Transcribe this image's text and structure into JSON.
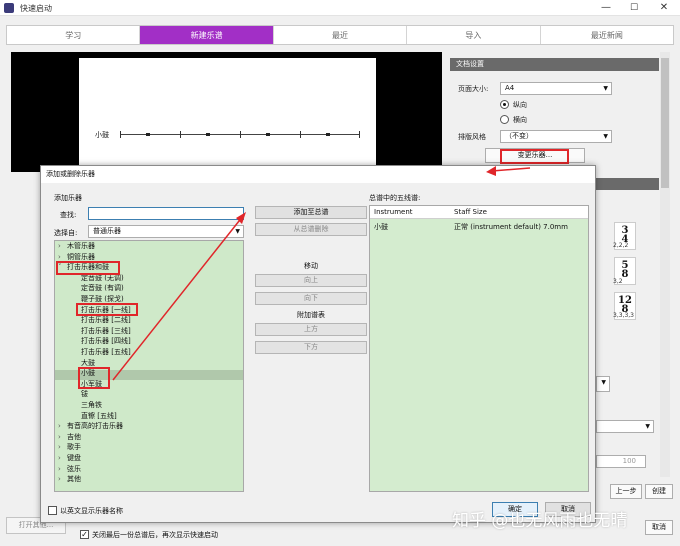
{
  "window": {
    "title": "快速启动",
    "minimize": "—",
    "maximize": "☐",
    "close": "✕"
  },
  "tabs": [
    {
      "label": "学习"
    },
    {
      "label": "新建乐谱"
    },
    {
      "label": "最近"
    },
    {
      "label": "导入"
    },
    {
      "label": "最近新闻"
    }
  ],
  "score": {
    "instrument_label": "小鼓"
  },
  "right_panel": {
    "header": "文档设置",
    "page_size_label": "页面大小:",
    "page_size_value": "A4",
    "portrait": "纵向",
    "landscape": "横向",
    "style_label": "排版风格",
    "style_value": "（不变）",
    "change_instruments": "变更乐器...",
    "time_sigs": [
      {
        "top": "3",
        "bottom": "4",
        "label": "2,2,2"
      },
      {
        "top": "5",
        "bottom": "8",
        "label": "3,2"
      },
      {
        "top": "12",
        "bottom": "8",
        "label": "3,3,3,3"
      }
    ],
    "tempo_value": "100"
  },
  "bottom": {
    "open_other": "打开其他...",
    "show_checkbox_label": "关闭最后一份总谱后，再次显示快速启动",
    "prev": "上一步",
    "create": "创建",
    "cancel": "取消"
  },
  "dialog": {
    "title": "添加或删除乐器",
    "add_label": "添加乐器",
    "search_label": "查找:",
    "search_value": "",
    "select_label": "选择自:",
    "select_value": "普通乐器",
    "tree": [
      {
        "label": "木管乐器",
        "level": 0,
        "exp": "›"
      },
      {
        "label": "铜管乐器",
        "level": 0,
        "exp": "›"
      },
      {
        "label": "打击乐器和鼓",
        "level": 0,
        "exp": "˅"
      },
      {
        "label": "定音鼓 (无调)",
        "level": 1,
        "exp": ""
      },
      {
        "label": "定音鼓 (有调)",
        "level": 1,
        "exp": ""
      },
      {
        "label": "鞭子鼓 (探戈)",
        "level": 1,
        "exp": ""
      },
      {
        "label": "打击乐器 [一线]",
        "level": 1,
        "exp": ""
      },
      {
        "label": "打击乐器 [二线]",
        "level": 1,
        "exp": ""
      },
      {
        "label": "打击乐器 [三线]",
        "level": 1,
        "exp": ""
      },
      {
        "label": "打击乐器 [四线]",
        "level": 1,
        "exp": ""
      },
      {
        "label": "打击乐器 [五线]",
        "level": 1,
        "exp": ""
      },
      {
        "label": "大鼓",
        "level": 1,
        "exp": ""
      },
      {
        "label": "小鼓",
        "level": 1,
        "exp": ""
      },
      {
        "label": "小军鼓",
        "level": 1,
        "exp": ""
      },
      {
        "label": "钹",
        "level": 1,
        "exp": ""
      },
      {
        "label": "三角铁",
        "level": 1,
        "exp": ""
      },
      {
        "label": "直镲 [五线]",
        "level": 1,
        "exp": ""
      },
      {
        "label": "有音高的打击乐器",
        "level": 0,
        "exp": "›"
      },
      {
        "label": "吉他",
        "level": 0,
        "exp": "›"
      },
      {
        "label": "歌手",
        "level": 0,
        "exp": "›"
      },
      {
        "label": "键盘",
        "level": 0,
        "exp": "›"
      },
      {
        "label": "弦乐",
        "level": 0,
        "exp": "›"
      },
      {
        "label": "其他",
        "level": 0,
        "exp": "›"
      }
    ],
    "add_to_score": "添加至总谱",
    "remove_from_score": "从总谱删除",
    "move_label": "移动",
    "up": "向上",
    "down": "向下",
    "extra_staff_label": "附加谱表",
    "above": "上方",
    "below": "下方",
    "staves_label": "总谱中的五线谱:",
    "col_instrument": "Instrument",
    "col_staff_size": "Staff Size",
    "rows": [
      {
        "instrument": "小鼓",
        "size": "正常 (instrument default) 7.0mm"
      }
    ],
    "english_names_label": "以英文显示乐器名称",
    "ok": "确定",
    "cancel": "取消"
  },
  "watermark": "知乎 @也无风雨也无晴",
  "colors": {
    "accent": "#a22fc6",
    "annotation_red": "#e0262a",
    "list_green": "#cfe9c9"
  }
}
